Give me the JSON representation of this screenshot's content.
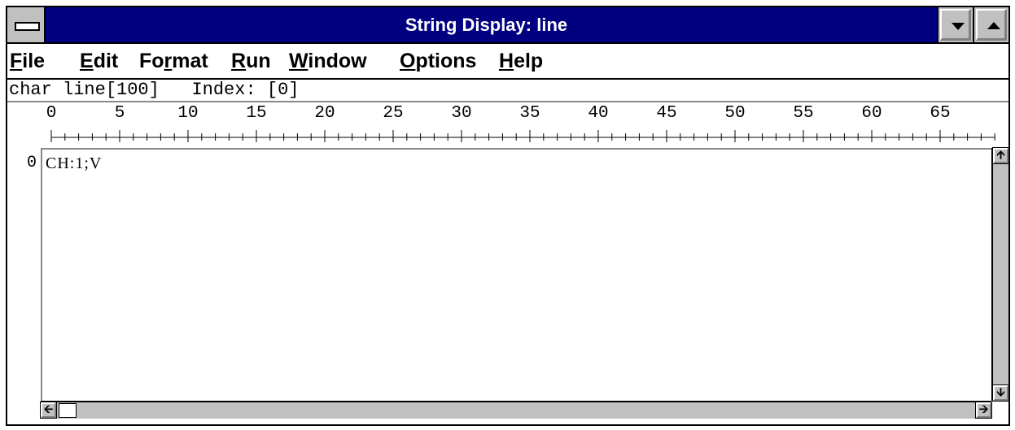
{
  "window": {
    "title": "String Display: line"
  },
  "menubar": {
    "items": [
      {
        "prefix": "",
        "accel": "F",
        "rest": "ile"
      },
      {
        "prefix": "",
        "accel": "E",
        "rest": "dit"
      },
      {
        "prefix": "Fo",
        "accel": "r",
        "rest": "mat"
      },
      {
        "prefix": "",
        "accel": "R",
        "rest": "un"
      },
      {
        "prefix": "",
        "accel": "W",
        "rest": "indow"
      },
      {
        "prefix": "",
        "accel": "O",
        "rest": "ptions"
      },
      {
        "prefix": "",
        "accel": "H",
        "rest": "elp"
      }
    ]
  },
  "info": {
    "declaration": "char line[100]",
    "index_label": "Index:",
    "index_value": "[0]"
  },
  "ruler": {
    "labels": [
      "0",
      "5",
      "10",
      "15",
      "20",
      "25",
      "30",
      "35",
      "40",
      "45",
      "50",
      "55",
      "60",
      "65"
    ]
  },
  "display": {
    "row_label": "0",
    "content": "CH:1;V"
  },
  "icons": {
    "system_menu": "system-menu-icon",
    "minimize": "minimize-arrow-icon",
    "maximize": "maximize-arrow-icon",
    "scroll_up": "scroll-up-arrow-icon",
    "scroll_down": "scroll-down-arrow-icon",
    "scroll_left": "scroll-left-arrow-icon",
    "scroll_right": "scroll-right-arrow-icon"
  }
}
